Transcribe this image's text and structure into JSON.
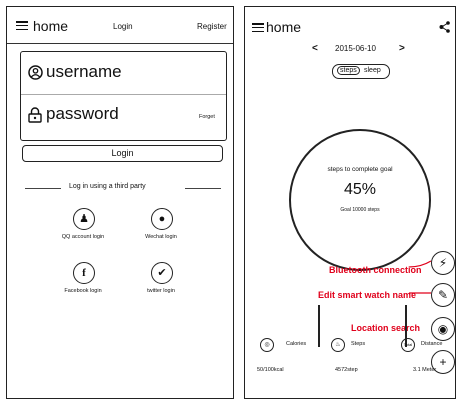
{
  "login_screen": {
    "header": {
      "title": "home",
      "login": "Login",
      "register": "Register"
    },
    "username_label": "username",
    "password_label": "password",
    "forgot": "Forget",
    "login_button": "Login",
    "third_party_title": "Log in using a third party",
    "socials": [
      {
        "icon": "qq-icon",
        "label": "QQ account login"
      },
      {
        "icon": "wechat-icon",
        "label": "Wechat login"
      },
      {
        "icon": "facebook-icon",
        "label": "Facebook login"
      },
      {
        "icon": "twitter-icon",
        "label": "twitter login"
      }
    ]
  },
  "home_screen": {
    "header": {
      "title": "home",
      "share_icon": "share-icon"
    },
    "date": "2015-06-10",
    "prev": "<",
    "next": ">",
    "toggle": [
      "steps",
      "sleep"
    ],
    "ring_title": "steps to complete goal",
    "percent": "45%",
    "percent_value": 0.45,
    "goal": "Goal 10000 steps",
    "annotations": [
      "Bluetooth connection",
      "Edit smart watch name",
      "Location search"
    ],
    "stats": [
      {
        "label": "Calories",
        "value": "50/100kcal"
      },
      {
        "label": "Steps",
        "value": "4572step"
      },
      {
        "label": "Distance",
        "value": "3.1 Meter"
      }
    ],
    "stat_icons": [
      "Total"
    ],
    "side_buttons": [
      "bluetooth-icon",
      "edit-icon",
      "location-icon",
      "add-icon"
    ],
    "accent_color": "#e0001b"
  }
}
